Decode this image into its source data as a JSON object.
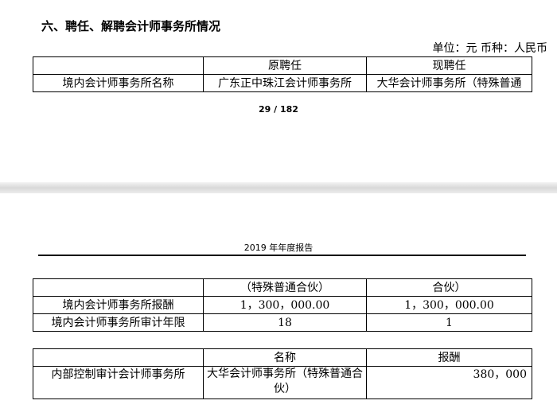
{
  "section": {
    "heading": "六、聘任、解聘会计师事务所情况",
    "unit": "单位：元   币种：人民币"
  },
  "table1": {
    "headers": [
      "",
      "原聘任",
      "现聘任"
    ],
    "row1": [
      "境内会计师事务所名称",
      "广东正中珠江会计师事务所",
      "大华会计师事务所（特殊普通"
    ]
  },
  "page_number": "29 / 182",
  "report_header": "2019 年年度报告",
  "table2": {
    "row0": [
      "",
      "（特殊普通合伙）",
      "合伙）"
    ],
    "row1": [
      "境内会计师事务所报酬",
      "1，300，000.00",
      "1，300，000.00"
    ],
    "row2": [
      "境内会计师事务所审计年限",
      "18",
      "1"
    ]
  },
  "table3": {
    "headers": [
      "",
      "名称",
      "报酬"
    ],
    "row1": [
      "内部控制审计会计师事务所",
      "大华会计师事务所（特殊普通合伙）",
      "380，000"
    ]
  }
}
